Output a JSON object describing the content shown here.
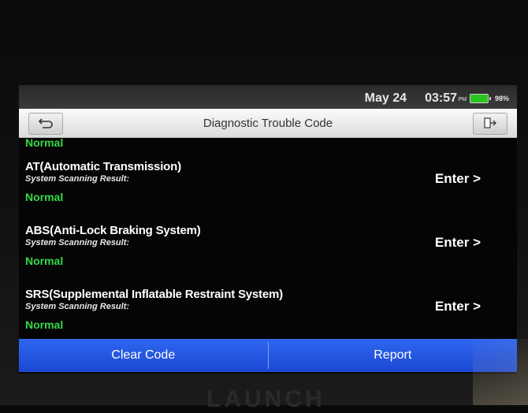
{
  "status_bar": {
    "date": "May 24",
    "time": "03:57",
    "ampm": "PM",
    "battery_percent": "98%"
  },
  "header": {
    "title": "Diagnostic Trouble Code"
  },
  "partial_result": "Normal",
  "systems": [
    {
      "name": "AT(Automatic Transmission)",
      "scan_label": "System Scanning Result:",
      "result": "Normal",
      "enter_label": "Enter >"
    },
    {
      "name": "ABS(Anti-Lock Braking System)",
      "scan_label": "System Scanning Result:",
      "result": "Normal",
      "enter_label": "Enter >"
    },
    {
      "name": "SRS(Supplemental Inflatable Restraint System)",
      "scan_label": "System Scanning Result:",
      "result": "Normal",
      "enter_label": "Enter >"
    }
  ],
  "bottom_bar": {
    "clear_label": "Clear Code",
    "report_label": "Report"
  },
  "brand": "LAUNCH",
  "colors": {
    "accent": "#2a5ae6",
    "normal": "#37d84a",
    "battery": "#29c41d"
  }
}
